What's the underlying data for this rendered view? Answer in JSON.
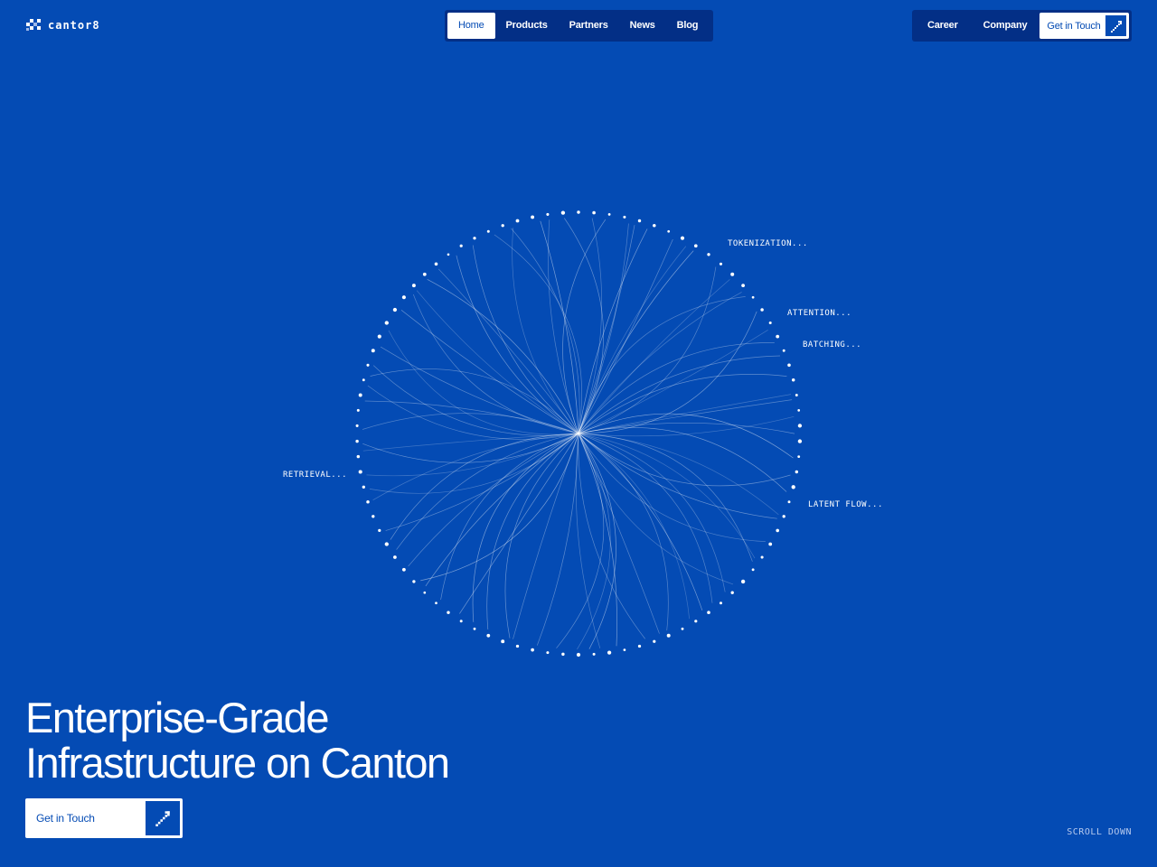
{
  "brand": {
    "name": "cantor8"
  },
  "nav": {
    "items": [
      "Home",
      "Products",
      "Partners",
      "News",
      "Blog"
    ],
    "active": "Home",
    "right_items": [
      "Career",
      "Company"
    ],
    "cta": "Get in Touch"
  },
  "visualization": {
    "labels": [
      "TOKENIZATION...",
      "ATTENTION...",
      "BATCHING...",
      "RETRIEVAL...",
      "LATENT FLOW..."
    ]
  },
  "hero": {
    "headline_line1": "Enterprise-Grade",
    "headline_line2": "Infrastructure on Canton",
    "cta": "Get in Touch"
  },
  "scroll_hint": "SCROLL DOWN",
  "colors": {
    "background": "#044bb4",
    "nav_background": "#032f86",
    "text": "#ffffff"
  },
  "icons": [
    "logo-mark-icon",
    "arrow-up-right-icon"
  ]
}
